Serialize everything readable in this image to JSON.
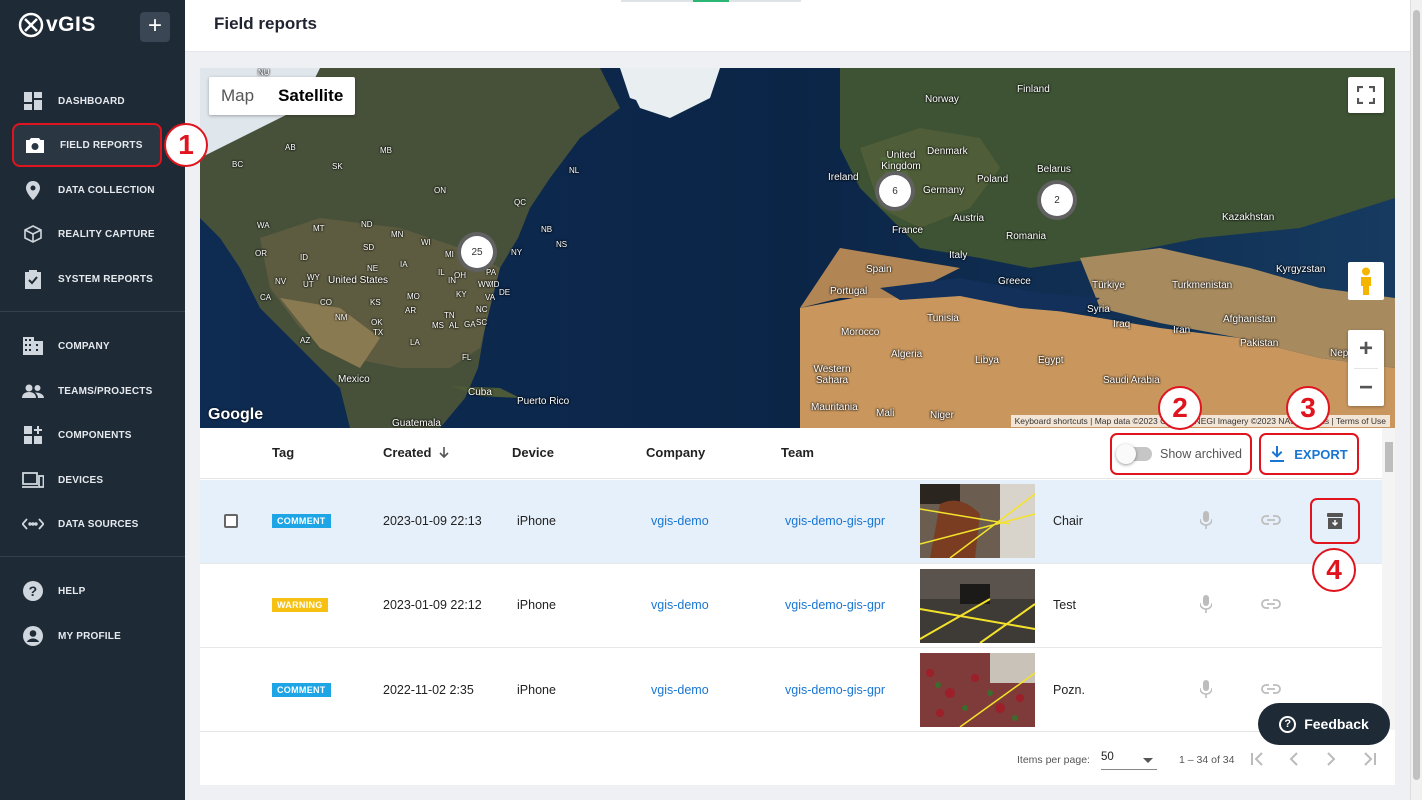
{
  "app": {
    "logo_text": "vGIS",
    "plus_label": "+"
  },
  "page": {
    "title": "Field reports"
  },
  "sidebar": {
    "items": [
      {
        "label": "DASHBOARD",
        "icon": "dashboard-icon"
      },
      {
        "label": "FIELD REPORTS",
        "icon": "camera-icon",
        "active": true
      },
      {
        "label": "DATA COLLECTION",
        "icon": "location-pin-icon"
      },
      {
        "label": "REALITY CAPTURE",
        "icon": "cube-icon"
      },
      {
        "label": "SYSTEM REPORTS",
        "icon": "clipboard-check-icon"
      },
      {
        "label": "COMPANY",
        "icon": "building-icon"
      },
      {
        "label": "TEAMS/PROJECTS",
        "icon": "people-icon"
      },
      {
        "label": "COMPONENTS",
        "icon": "widgets-icon"
      },
      {
        "label": "DEVICES",
        "icon": "devices-icon"
      },
      {
        "label": "DATA SOURCES",
        "icon": "code-arrows-icon"
      },
      {
        "label": "HELP",
        "icon": "help-icon"
      },
      {
        "label": "MY PROFILE",
        "icon": "profile-icon"
      }
    ]
  },
  "map": {
    "type_map": "Map",
    "type_satellite": "Satellite",
    "google": "Google",
    "attribution": "Keyboard shortcuts | Map data ©2023 Google, INEGI Imagery ©2023 NASA, Terms | Terms of Use",
    "clusters": [
      "25",
      "6",
      "2"
    ],
    "labels": [
      "Norway",
      "Finland",
      "Denmark",
      "United Kingdom",
      "Ireland",
      "Germany",
      "Poland",
      "Belarus",
      "France",
      "Austria",
      "Romania",
      "Italy",
      "Kazakhstan",
      "Spain",
      "Portugal",
      "Greece",
      "Türkiye",
      "Kyrgyzstan",
      "Turkmenistan",
      "Syria",
      "Iraq",
      "Iran",
      "Afghanistan",
      "Tunisia",
      "Pakistan",
      "Morocco",
      "Algeria",
      "Libya",
      "Egypt",
      "Western Sahara",
      "Saudi Arabia",
      "Mauritania",
      "Mali",
      "Nepal",
      "Niger",
      "United States",
      "Mexico",
      "Cuba",
      "Puerto Rico",
      "Guatemala"
    ],
    "small_labels": [
      "NU",
      "AB",
      "MB",
      "BC",
      "SK",
      "NL",
      "ON",
      "QC",
      "WA",
      "MT",
      "ND",
      "MN",
      "OR",
      "ID",
      "SD",
      "WI",
      "MI",
      "NB",
      "NS",
      "NV",
      "UT",
      "NE",
      "IA",
      "OH",
      "PA",
      "NY",
      "CA",
      "CO",
      "KS",
      "MO",
      "KY",
      "VA",
      "MD",
      "DE",
      "AZ",
      "NM",
      "OK",
      "AR",
      "TN",
      "NC",
      "TX",
      "LA",
      "MS",
      "AL",
      "GA",
      "SC",
      "FL",
      "WY",
      "IL",
      "IN",
      "WV"
    ]
  },
  "table": {
    "headers": {
      "tag": "Tag",
      "created": "Created",
      "device": "Device",
      "company": "Company",
      "team": "Team"
    },
    "show_archived": "Show archived",
    "export": "EXPORT",
    "rows": [
      {
        "tag": "COMMENT",
        "created": "2023-01-09 22:13",
        "device": "iPhone",
        "company": "vgis-demo",
        "team": "vgis-demo-gis-gpr",
        "name": "Chair"
      },
      {
        "tag": "WARNING",
        "created": "2023-01-09 22:12",
        "device": "iPhone",
        "company": "vgis-demo",
        "team": "vgis-demo-gis-gpr",
        "name": "Test"
      },
      {
        "tag": "COMMENT",
        "created": "2022-11-02 2:35",
        "device": "iPhone",
        "company": "vgis-demo",
        "team": "vgis-demo-gis-gpr",
        "name": "Pozn."
      }
    ],
    "pagination": {
      "items_per_page_label": "Items per page:",
      "items_per_page": "50",
      "range": "1 – 34 of 34"
    }
  },
  "annotations": [
    "1",
    "2",
    "3",
    "4"
  ],
  "feedback": {
    "label": "Feedback",
    "icon": "question-icon"
  },
  "colors": {
    "sidebar": "#1e2a36",
    "accent": "#1976d2",
    "highlight": "#e0141e",
    "comment": "#1ea5e5",
    "warning": "#f7c113"
  }
}
